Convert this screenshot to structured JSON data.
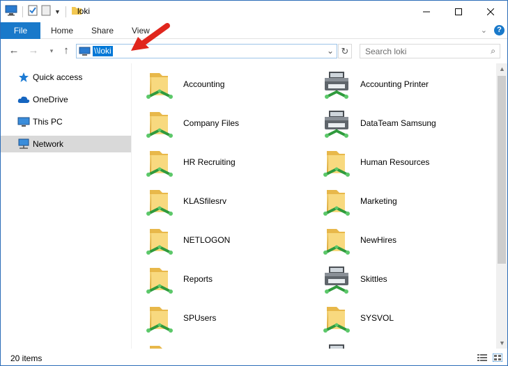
{
  "window": {
    "title": "loki"
  },
  "ribbon": {
    "tabs": [
      "File",
      "Home",
      "Share",
      "View"
    ],
    "help": "?"
  },
  "nav": {
    "address": "\\\\loki",
    "search_placeholder": "Search loki"
  },
  "sidebar": {
    "items": [
      {
        "label": "Quick access",
        "icon": "star-icon"
      },
      {
        "label": "OneDrive",
        "icon": "cloud-icon"
      },
      {
        "label": "This PC",
        "icon": "computer-icon"
      },
      {
        "label": "Network",
        "icon": "network-icon",
        "selected": true
      }
    ]
  },
  "content": {
    "items": [
      {
        "label": "Accounting",
        "type": "shared-folder"
      },
      {
        "label": "Accounting Printer",
        "type": "printer"
      },
      {
        "label": "Company Files",
        "type": "shared-folder"
      },
      {
        "label": "DataTeam Samsung",
        "type": "printer"
      },
      {
        "label": "HR Recruiting",
        "type": "shared-folder"
      },
      {
        "label": "Human Resources",
        "type": "shared-folder"
      },
      {
        "label": "KLASfilesrv",
        "type": "shared-folder"
      },
      {
        "label": "Marketing",
        "type": "shared-folder"
      },
      {
        "label": "NETLOGON",
        "type": "shared-folder"
      },
      {
        "label": "NewHires",
        "type": "shared-folder"
      },
      {
        "label": "Reports",
        "type": "shared-folder"
      },
      {
        "label": "Skittles",
        "type": "printer"
      },
      {
        "label": "SPUsers",
        "type": "shared-folder"
      },
      {
        "label": "SYSVOL",
        "type": "shared-folder"
      }
    ]
  },
  "status": {
    "count": "20 items"
  },
  "colors": {
    "accent": "#1979ca",
    "selection": "#0078d7",
    "folder": "#f4d27a",
    "share_arrow": "#3aa845",
    "annotation": "#e0261d"
  }
}
